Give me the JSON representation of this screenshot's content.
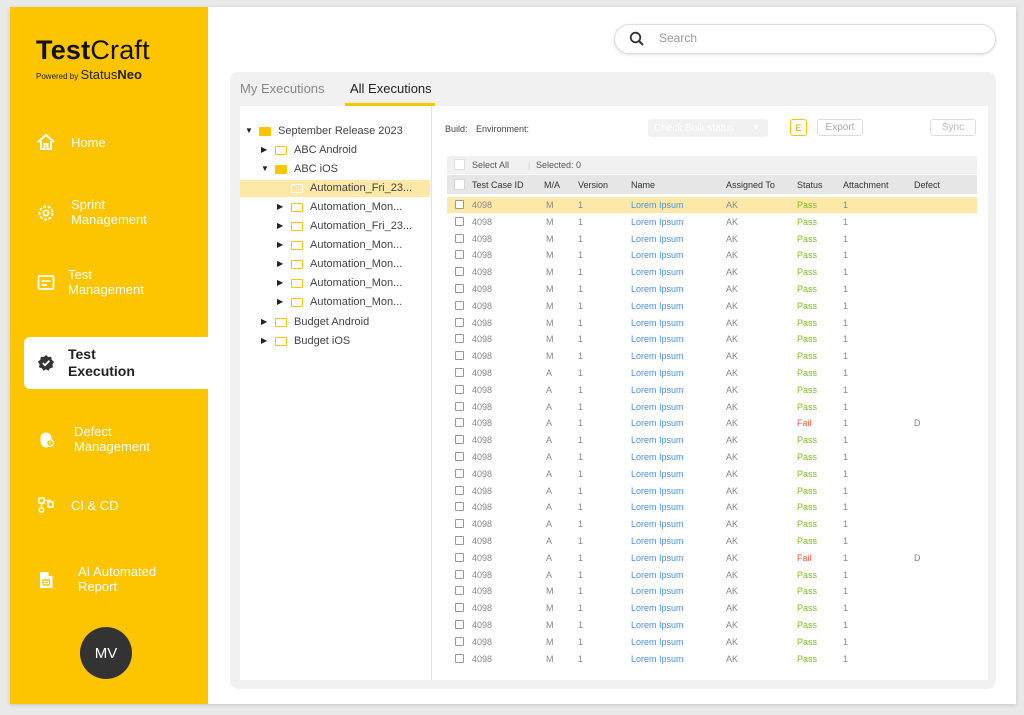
{
  "app": {
    "logo_bold": "Test",
    "logo_light": "Craft",
    "powered_by": "Powered by",
    "powered_brand_light": "Status",
    "powered_brand_bold": "Neo"
  },
  "sidebar": {
    "items": [
      {
        "label_line1": "Home",
        "label_line2": "",
        "icon": "home-icon"
      },
      {
        "label_line1": "Sprint",
        "label_line2": "Management",
        "icon": "gear-icon"
      },
      {
        "label_line1": "Test",
        "label_line2": "Management",
        "icon": "test-management-icon"
      },
      {
        "label_line1": "Test",
        "label_line2": "Execution",
        "icon": "badge-check-icon",
        "active": true
      },
      {
        "label_line1": "Defect",
        "label_line2": "Management",
        "icon": "bug-icon"
      },
      {
        "label_line1": "CI & CD",
        "label_line2": "",
        "icon": "pipeline-icon"
      },
      {
        "label_line1": "AI Automated",
        "label_line2": "Report",
        "icon": "report-icon"
      }
    ],
    "avatar_initials": "MV"
  },
  "search": {
    "placeholder": "Search"
  },
  "tabs": [
    {
      "label": "My Executions",
      "active": false
    },
    {
      "label": "All Executions",
      "active": true
    }
  ],
  "tree": {
    "root": "September Release 2023",
    "items": [
      "ABC Android",
      "ABC iOS",
      "Automation_Fri_23...",
      "Automation_Mon...",
      "Automation_Fri_23...",
      "Automation_Mon...",
      "Automation_Mon...",
      "Automation_Mon...",
      "Automation_Mon...",
      "Budget Android",
      "Budget iOS"
    ]
  },
  "toolbar": {
    "build_label": "Build:",
    "environment_label": "Environment:",
    "bulk_status": "Check Bulk status",
    "e_button": "E",
    "export_button": "Export",
    "sync_button": "Sync"
  },
  "table": {
    "select_all": "Select All",
    "selected": "Selected: 0",
    "columns": [
      "Test Case ID",
      "M/A",
      "Version",
      "Name",
      "Assigned To",
      "Status",
      "Attachment",
      "Defect"
    ],
    "rows": [
      {
        "id": "4098",
        "ma": "M",
        "ver": "1",
        "name": "Lorem Ipsum",
        "assigned": "AK",
        "status": "Pass",
        "att": "1",
        "defect": ""
      },
      {
        "id": "4098",
        "ma": "M",
        "ver": "1",
        "name": "Lorem Ipsum",
        "assigned": "AK",
        "status": "Pass",
        "att": "1",
        "defect": ""
      },
      {
        "id": "4098",
        "ma": "M",
        "ver": "1",
        "name": "Lorem Ipsum",
        "assigned": "AK",
        "status": "Pass",
        "att": "1",
        "defect": ""
      },
      {
        "id": "4098",
        "ma": "M",
        "ver": "1",
        "name": "Lorem Ipsum",
        "assigned": "AK",
        "status": "Pass",
        "att": "1",
        "defect": ""
      },
      {
        "id": "4098",
        "ma": "M",
        "ver": "1",
        "name": "Lorem Ipsum",
        "assigned": "AK",
        "status": "Pass",
        "att": "1",
        "defect": ""
      },
      {
        "id": "4098",
        "ma": "M",
        "ver": "1",
        "name": "Lorem Ipsum",
        "assigned": "AK",
        "status": "Pass",
        "att": "1",
        "defect": ""
      },
      {
        "id": "4098",
        "ma": "M",
        "ver": "1",
        "name": "Lorem Ipsum",
        "assigned": "AK",
        "status": "Pass",
        "att": "1",
        "defect": ""
      },
      {
        "id": "4098",
        "ma": "M",
        "ver": "1",
        "name": "Lorem Ipsum",
        "assigned": "AK",
        "status": "Pass",
        "att": "1",
        "defect": ""
      },
      {
        "id": "4098",
        "ma": "M",
        "ver": "1",
        "name": "Lorem Ipsum",
        "assigned": "AK",
        "status": "Pass",
        "att": "1",
        "defect": ""
      },
      {
        "id": "4098",
        "ma": "M",
        "ver": "1",
        "name": "Lorem Ipsum",
        "assigned": "AK",
        "status": "Pass",
        "att": "1",
        "defect": ""
      },
      {
        "id": "4098",
        "ma": "A",
        "ver": "1",
        "name": "Lorem Ipsum",
        "assigned": "AK",
        "status": "Pass",
        "att": "1",
        "defect": ""
      },
      {
        "id": "4098",
        "ma": "A",
        "ver": "1",
        "name": "Lorem Ipsum",
        "assigned": "AK",
        "status": "Pass",
        "att": "1",
        "defect": ""
      },
      {
        "id": "4098",
        "ma": "A",
        "ver": "1",
        "name": "Lorem Ipsum",
        "assigned": "AK",
        "status": "Pass",
        "att": "1",
        "defect": ""
      },
      {
        "id": "4098",
        "ma": "A",
        "ver": "1",
        "name": "Lorem Ipsum",
        "assigned": "AK",
        "status": "Fail",
        "att": "1",
        "defect": "D"
      },
      {
        "id": "4098",
        "ma": "A",
        "ver": "1",
        "name": "Lorem Ipsum",
        "assigned": "AK",
        "status": "Pass",
        "att": "1",
        "defect": ""
      },
      {
        "id": "4098",
        "ma": "A",
        "ver": "1",
        "name": "Lorem Ipsum",
        "assigned": "AK",
        "status": "Pass",
        "att": "1",
        "defect": ""
      },
      {
        "id": "4098",
        "ma": "A",
        "ver": "1",
        "name": "Lorem Ipsum",
        "assigned": "AK",
        "status": "Pass",
        "att": "1",
        "defect": ""
      },
      {
        "id": "4098",
        "ma": "A",
        "ver": "1",
        "name": "Lorem Ipsum",
        "assigned": "AK",
        "status": "Pass",
        "att": "1",
        "defect": ""
      },
      {
        "id": "4098",
        "ma": "A",
        "ver": "1",
        "name": "Lorem Ipsum",
        "assigned": "AK",
        "status": "Pass",
        "att": "1",
        "defect": ""
      },
      {
        "id": "4098",
        "ma": "A",
        "ver": "1",
        "name": "Lorem Ipsum",
        "assigned": "AK",
        "status": "Pass",
        "att": "1",
        "defect": ""
      },
      {
        "id": "4098",
        "ma": "A",
        "ver": "1",
        "name": "Lorem Ipsum",
        "assigned": "AK",
        "status": "Pass",
        "att": "1",
        "defect": ""
      },
      {
        "id": "4098",
        "ma": "A",
        "ver": "1",
        "name": "Lorem Ipsum",
        "assigned": "AK",
        "status": "Fail",
        "att": "1",
        "defect": "D"
      },
      {
        "id": "4098",
        "ma": "A",
        "ver": "1",
        "name": "Lorem Ipsum",
        "assigned": "AK",
        "status": "Pass",
        "att": "1",
        "defect": ""
      },
      {
        "id": "4098",
        "ma": "M",
        "ver": "1",
        "name": "Lorem Ipsum",
        "assigned": "AK",
        "status": "Pass",
        "att": "1",
        "defect": ""
      },
      {
        "id": "4098",
        "ma": "M",
        "ver": "1",
        "name": "Lorem Ipsum",
        "assigned": "AK",
        "status": "Pass",
        "att": "1",
        "defect": ""
      },
      {
        "id": "4098",
        "ma": "M",
        "ver": "1",
        "name": "Lorem Ipsum",
        "assigned": "AK",
        "status": "Pass",
        "att": "1",
        "defect": ""
      },
      {
        "id": "4098",
        "ma": "M",
        "ver": "1",
        "name": "Lorem Ipsum",
        "assigned": "AK",
        "status": "Pass",
        "att": "1",
        "defect": ""
      },
      {
        "id": "4098",
        "ma": "M",
        "ver": "1",
        "name": "Lorem Ipsum",
        "assigned": "AK",
        "status": "Pass",
        "att": "1",
        "defect": ""
      }
    ]
  },
  "colors": {
    "brand": "#fdc400",
    "highlight": "#fde9a7",
    "pass": "#7cc21a",
    "fail": "#f05a3e",
    "link": "#4a90e2"
  }
}
